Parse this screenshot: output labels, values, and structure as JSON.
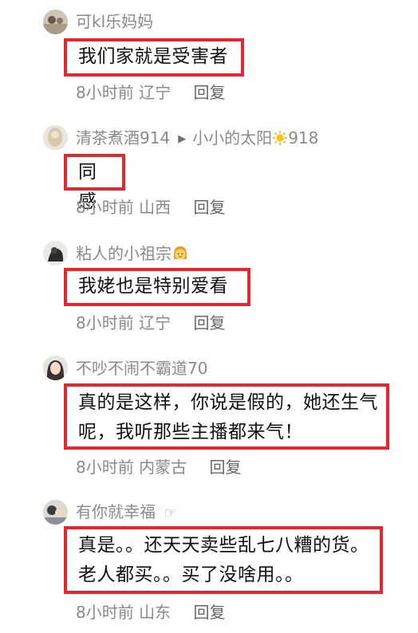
{
  "comments": [
    {
      "username": "可kl乐妈妈",
      "reply_to": "",
      "reply_to_suffix": "",
      "text": "我们家就是受害者",
      "time": "8小时前",
      "location": "辽宁",
      "reply_label": "回复"
    },
    {
      "username": "清茶煮酒914",
      "reply_to": "小小的太阳",
      "reply_to_suffix": "918",
      "text": "同感",
      "time": "8小时前",
      "location": "山西",
      "reply_label": "回复"
    },
    {
      "username": "粘人的小祖宗",
      "reply_to": "",
      "reply_to_suffix": "",
      "text": "我姥也是特别爱看",
      "time": "8小时前",
      "location": "辽宁",
      "reply_label": "回复"
    },
    {
      "username": "不吵不闹不霸道70",
      "reply_to": "",
      "reply_to_suffix": "",
      "text": "真的是这样，你说是假的，她还生气呢，我听那些主播都来气！",
      "time": "8小时前",
      "location": "内蒙古",
      "reply_label": "回复"
    },
    {
      "username": "有你就幸福",
      "reply_to": "",
      "reply_to_suffix": "",
      "text": "真是。。还天天卖些乱七八糟的货。老人都买。。买了没啥用。。",
      "time": "8小时前",
      "location": "山东",
      "reply_label": "回复"
    }
  ],
  "colors": {
    "highlight_border": "#e8262d",
    "username": "#8a8a8a",
    "body_text": "#111111",
    "meta_text": "#8a8a8a"
  },
  "icons": {
    "reply_arrow": "play-triangle-icon",
    "sun_emoji": "sun-icon",
    "girl_emoji": "girl-face-icon",
    "hand_emoji": "pointing-hand-icon"
  }
}
